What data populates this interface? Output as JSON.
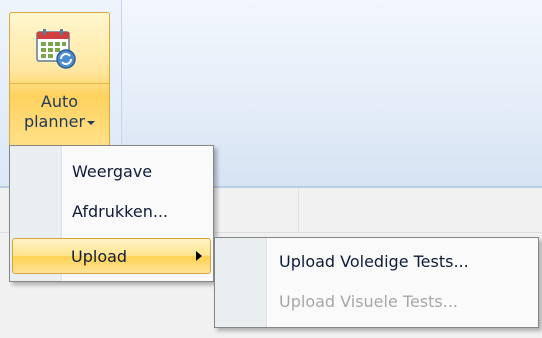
{
  "ribbon": {
    "auto_planner": {
      "line1": "Auto",
      "line2": "planner",
      "icon": "calendar-sync-icon"
    }
  },
  "menu": {
    "items": [
      {
        "label": "Weergave",
        "enabled": true
      },
      {
        "label": "Afdrukken...",
        "enabled": true
      },
      {
        "label": "Upload",
        "enabled": true,
        "highlighted": true,
        "has_submenu": true
      }
    ]
  },
  "submenu": {
    "items": [
      {
        "label": "Upload Voledige Tests...",
        "enabled": true
      },
      {
        "label": "Upload Visuele Tests...",
        "enabled": false
      }
    ]
  },
  "colors": {
    "highlight": "#ffd151",
    "menu_text": "#0e1d3b",
    "disabled_text": "#a7a7a7"
  }
}
